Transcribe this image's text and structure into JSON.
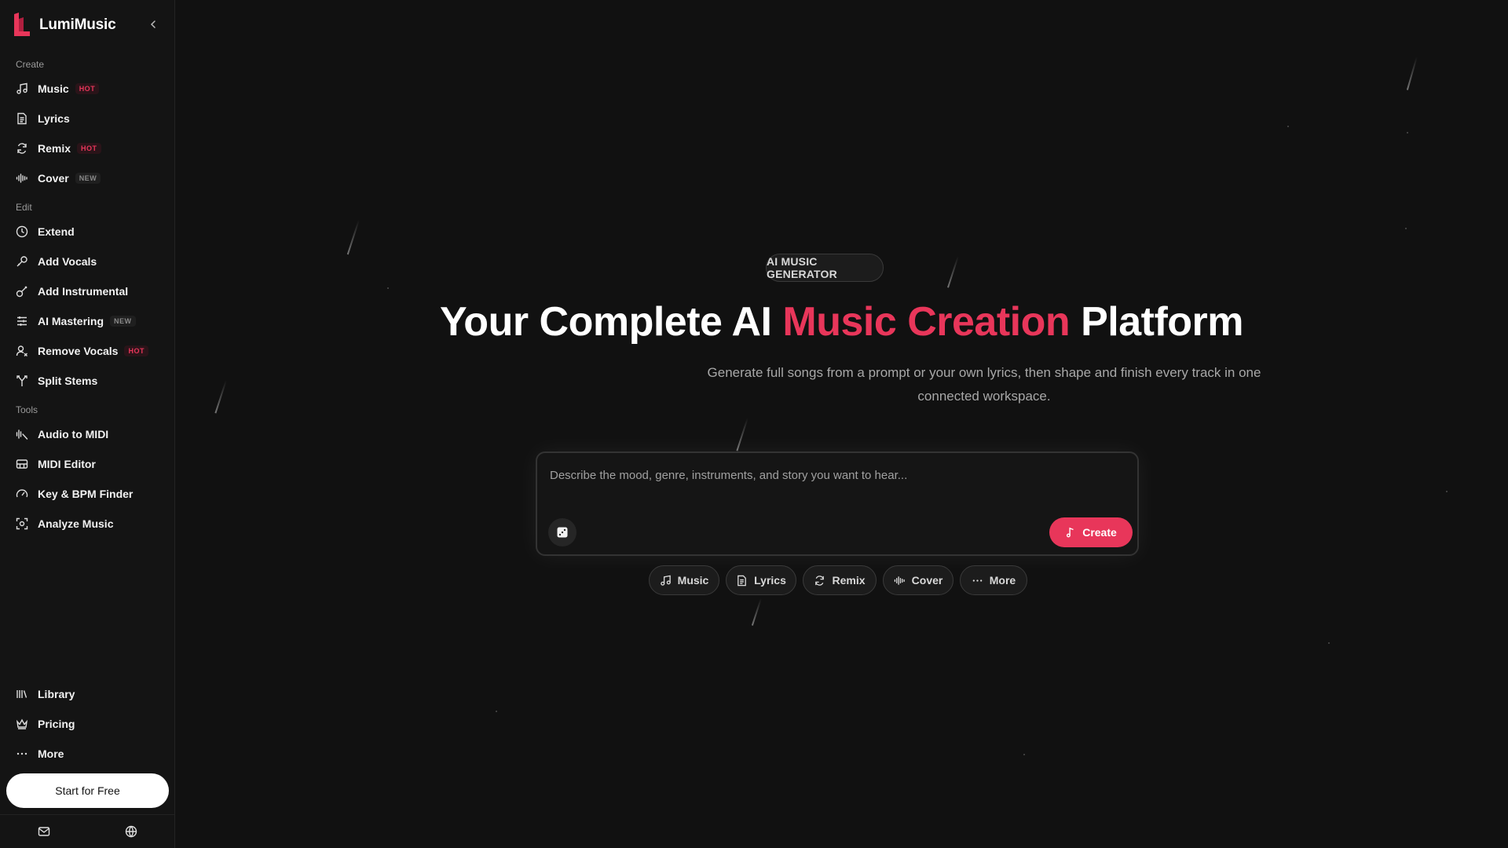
{
  "brand": {
    "name": "LumiMusic",
    "accent": "#e8365a"
  },
  "sidebar": {
    "sections": {
      "create": "Create",
      "edit": "Edit",
      "tools": "Tools"
    },
    "create_items": [
      {
        "label": "Music",
        "badge": "HOT",
        "icon": "music-note-icon"
      },
      {
        "label": "Lyrics",
        "badge": "",
        "icon": "document-icon"
      },
      {
        "label": "Remix",
        "badge": "HOT",
        "icon": "refresh-icon"
      },
      {
        "label": "Cover",
        "badge": "NEW",
        "icon": "waveform-icon"
      }
    ],
    "edit_items": [
      {
        "label": "Extend",
        "badge": "",
        "icon": "clock-icon"
      },
      {
        "label": "Add Vocals",
        "badge": "",
        "icon": "microphone-icon"
      },
      {
        "label": "Add Instrumental",
        "badge": "",
        "icon": "guitar-icon"
      },
      {
        "label": "AI Mastering",
        "badge": "NEW",
        "icon": "sliders-icon"
      },
      {
        "label": "Remove Vocals",
        "badge": "HOT",
        "icon": "user-remove-icon"
      },
      {
        "label": "Split Stems",
        "badge": "",
        "icon": "split-icon"
      }
    ],
    "tools_items": [
      {
        "label": "Audio to MIDI",
        "badge": "",
        "icon": "audio-midi-icon"
      },
      {
        "label": "MIDI Editor",
        "badge": "",
        "icon": "piano-icon"
      },
      {
        "label": "Key & BPM Finder",
        "badge": "",
        "icon": "gauge-icon"
      },
      {
        "label": "Analyze Music",
        "badge": "",
        "icon": "scan-icon"
      }
    ],
    "bottom_items": [
      {
        "label": "Library",
        "icon": "library-icon"
      },
      {
        "label": "Pricing",
        "icon": "crown-icon"
      },
      {
        "label": "More",
        "icon": "dots-icon"
      }
    ],
    "start_free_label": "Start for Free"
  },
  "hero": {
    "tag": "AI MUSIC GENERATOR",
    "title_part1": "Your Complete AI ",
    "title_accent": "Music Creation",
    "title_part2": " Platform",
    "subtitle": "Generate full songs from a prompt or your own lyrics, then shape and finish every track in one connected workspace."
  },
  "prompt": {
    "placeholder": "Describe the mood, genre, instruments, and story you want to hear...",
    "create_label": "Create"
  },
  "chips": [
    {
      "label": "Music",
      "icon": "music-note-icon"
    },
    {
      "label": "Lyrics",
      "icon": "document-icon"
    },
    {
      "label": "Remix",
      "icon": "refresh-icon"
    },
    {
      "label": "Cover",
      "icon": "waveform-icon"
    },
    {
      "label": "More",
      "icon": "dots-icon"
    }
  ]
}
